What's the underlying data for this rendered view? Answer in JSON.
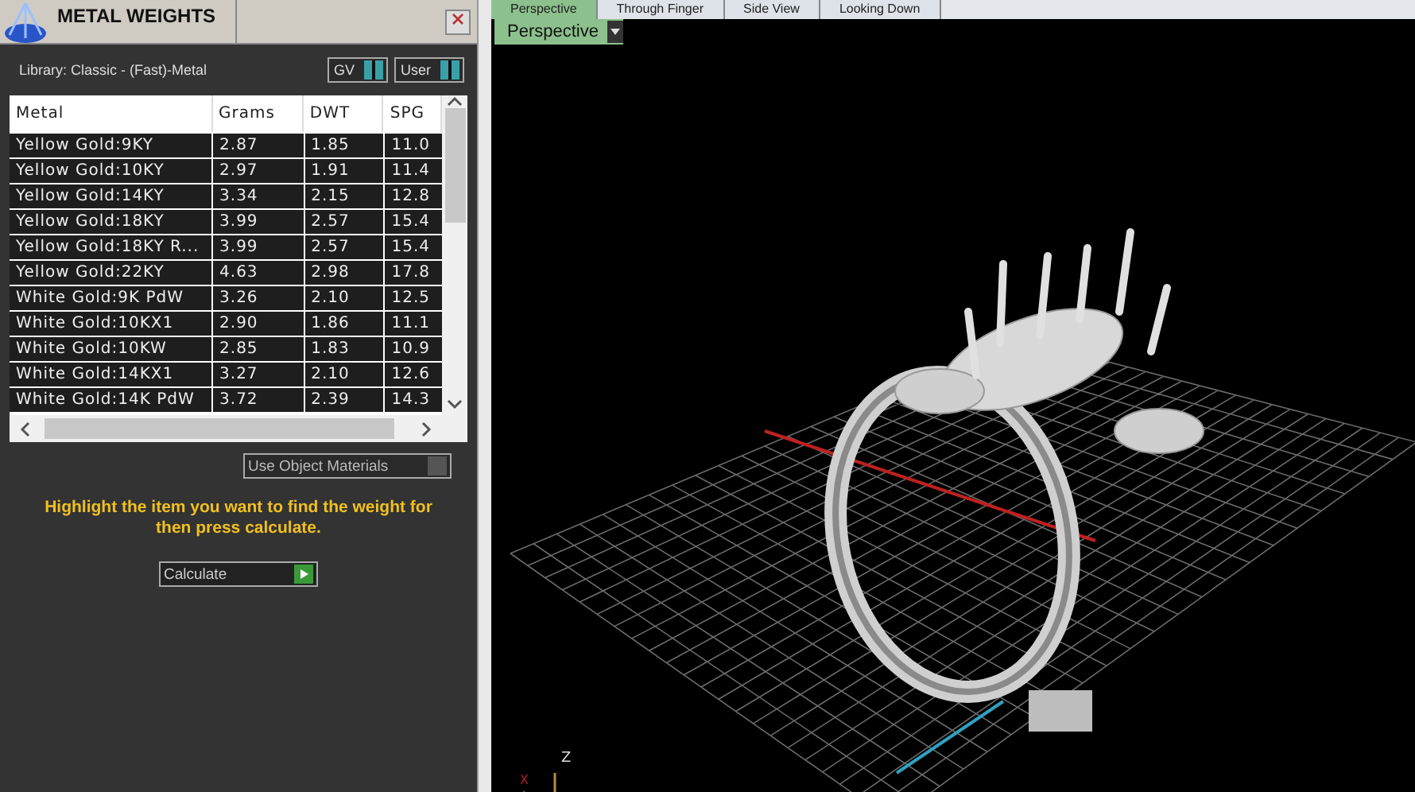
{
  "panel": {
    "title": "METAL WEIGHTS",
    "library": "Library: Classic - (Fast)-Metal",
    "toggles": [
      {
        "label": "GV",
        "on": true
      },
      {
        "label": "User",
        "on": true
      }
    ],
    "table": {
      "columns": [
        "Metal",
        "Grams",
        "DWT",
        "SPG"
      ],
      "rows": [
        {
          "cells": [
            "Yellow Gold:9KY",
            "2.87",
            "1.85",
            "11.0"
          ],
          "selected": false
        },
        {
          "cells": [
            "Yellow Gold:10KY",
            "2.97",
            "1.91",
            "11.4"
          ],
          "selected": false
        },
        {
          "cells": [
            "Yellow Gold:14KY",
            "3.34",
            "2.15",
            "12.8"
          ],
          "selected": false
        },
        {
          "cells": [
            "Yellow Gold:18KY",
            "3.99",
            "2.57",
            "15.4"
          ],
          "selected": false
        },
        {
          "cells": [
            "Yellow Gold:18KY R...",
            "3.99",
            "2.57",
            "15.4"
          ],
          "selected": false
        },
        {
          "cells": [
            "Yellow Gold:22KY",
            "4.63",
            "2.98",
            "17.8"
          ],
          "selected": false
        },
        {
          "cells": [
            "White Gold:9K PdW",
            "3.26",
            "2.10",
            "12.5"
          ],
          "selected": false
        },
        {
          "cells": [
            "White Gold:10KX1",
            "2.90",
            "1.86",
            "11.1"
          ],
          "selected": false
        },
        {
          "cells": [
            "White Gold:10KW",
            "2.85",
            "1.83",
            "10.9"
          ],
          "selected": false
        },
        {
          "cells": [
            "White Gold:14KX1",
            "3.27",
            "2.10",
            "12.6"
          ],
          "selected": false
        },
        {
          "cells": [
            "White Gold:14K PdW",
            "3.72",
            "2.39",
            "14.3"
          ],
          "selected": false
        }
      ]
    },
    "use_object_materials": {
      "label": "Use Object Materials",
      "checked": false
    },
    "instruction": "Highlight the item you want to find the weight for then press calculate.",
    "calculate_button": "Calculate"
  },
  "viewport": {
    "tabs": [
      {
        "label": "Perspective",
        "selected": true
      },
      {
        "label": "Through Finger",
        "selected": false
      },
      {
        "label": "Side View",
        "selected": false
      },
      {
        "label": "Looking Down",
        "selected": false
      }
    ],
    "view_dropdown": "Perspective",
    "axes": [
      "Z",
      "X"
    ]
  }
}
